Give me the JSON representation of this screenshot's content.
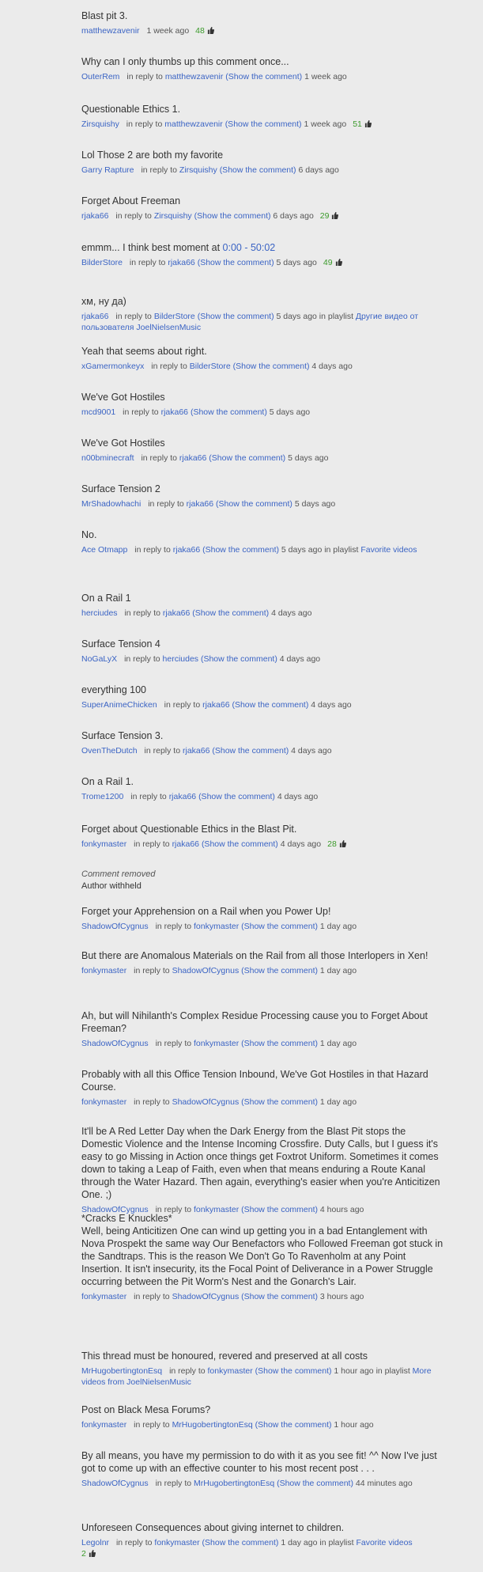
{
  "comments": [
    {
      "text": "Blast pit 3.",
      "user": "matthewzavenir",
      "reply_prefix": "",
      "reply_to": "",
      "show": "",
      "time": "1 week ago",
      "likes": "48"
    },
    {
      "text": "Why can I only thumbs up this comment once...",
      "user": "OuterRem",
      "reply_prefix": "in reply to",
      "reply_to": "matthewzavenir",
      "show": "(Show the comment)",
      "time": "1 week ago"
    },
    {
      "text": "Questionable Ethics 1.",
      "user": "Zirsquishy",
      "reply_prefix": "in reply to",
      "reply_to": "matthewzavenir",
      "show": "(Show the comment)",
      "time": "1 week ago",
      "likes": "51"
    },
    {
      "text": "Lol Those 2 are both my favorite",
      "user": "Garry Rapture",
      "reply_prefix": "in reply to",
      "reply_to": "Zirsquishy",
      "show": "(Show the comment)",
      "time": "6 days ago"
    },
    {
      "text": "Forget About Freeman",
      "user": "rjaka66",
      "reply_prefix": "in reply to",
      "reply_to": "Zirsquishy",
      "show": "(Show the comment)",
      "time": "6 days ago",
      "likes": "29"
    },
    {
      "text": "emmm... I think best moment at ",
      "link": "0:00 - 50:02",
      "user": "BilderStore",
      "reply_prefix": "in reply to",
      "reply_to": "rjaka66",
      "show": "(Show the comment)",
      "time": "5 days ago",
      "likes": "49"
    },
    {
      "text": "хм, ну да)",
      "user": "rjaka66",
      "reply_prefix": "in reply to",
      "reply_to": "BilderStore",
      "show": "(Show the comment)",
      "time": "5 days ago",
      "playlist_prefix": "in playlist",
      "playlist": "Другие видео от пользователя JoelNielsenMusic"
    },
    {
      "text": "Yeah that seems about right.",
      "user": "xGamermonkeyx",
      "reply_prefix": "in reply to",
      "reply_to": "BilderStore",
      "show": "(Show the comment)",
      "time": "4 days ago"
    },
    {
      "text": "We've Got Hostiles",
      "user": "mcd9001",
      "reply_prefix": "in reply to",
      "reply_to": "rjaka66",
      "show": "(Show the comment)",
      "time": "5 days ago"
    },
    {
      "text": "We've Got Hostiles",
      "user": "n00bminecraft",
      "reply_prefix": "in reply to",
      "reply_to": "rjaka66",
      "show": "(Show the comment)",
      "time": "5 days ago"
    },
    {
      "text": "Surface Tension 2",
      "user": "MrShadowhachi",
      "reply_prefix": "in reply to",
      "reply_to": "rjaka66",
      "show": "(Show the comment)",
      "time": "5 days ago"
    },
    {
      "text": "No.",
      "user": "Ace Otmapp",
      "reply_prefix": "in reply to",
      "reply_to": "rjaka66",
      "show": "(Show the comment)",
      "time": "5 days ago",
      "playlist_prefix": "in playlist",
      "playlist": "Favorite videos"
    },
    {
      "text": "On a Rail 1",
      "user": "herciudes",
      "reply_prefix": "in reply to",
      "reply_to": "rjaka66",
      "show": "(Show the comment)",
      "time": "4 days ago"
    },
    {
      "text": "Surface Tension 4",
      "user": "NoGaLyX",
      "reply_prefix": "in reply to",
      "reply_to": "herciudes",
      "show": "(Show the comment)",
      "time": "4 days ago"
    },
    {
      "text": "everything 100",
      "user": "SuperAnimeChicken",
      "reply_prefix": "in reply to",
      "reply_to": "rjaka66",
      "show": "(Show the comment)",
      "time": "4 days ago"
    },
    {
      "text": "Surface Tension 3.",
      "user": "OvenTheDutch",
      "reply_prefix": "in reply to",
      "reply_to": "rjaka66",
      "show": "(Show the comment)",
      "time": "4 days ago"
    },
    {
      "text": "On a Rail 1.",
      "user": "Trome1200",
      "reply_prefix": "in reply to",
      "reply_to": "rjaka66",
      "show": "(Show the comment)",
      "time": "4 days ago"
    },
    {
      "text": "Forget about Questionable Ethics in the Blast Pit.",
      "user": "fonkymaster",
      "reply_prefix": "in reply to",
      "reply_to": "rjaka66",
      "show": "(Show the comment)",
      "time": "4 days ago",
      "likes": "28"
    },
    {
      "removed": true,
      "text": "Comment removed",
      "withheld": "Author withheld"
    },
    {
      "text": "Forget your Apprehension on a Rail when you Power Up!",
      "user": "ShadowOfCygnus",
      "reply_prefix": "in reply to",
      "reply_to": "fonkymaster",
      "show": "(Show the comment)",
      "time": "1 day ago"
    },
    {
      "text": "But there are Anomalous Materials on the Rail from all those Interlopers in Xen!",
      "user": "fonkymaster",
      "reply_prefix": "in reply to",
      "reply_to": "ShadowOfCygnus",
      "show": "(Show the comment)",
      "time": "1 day ago"
    },
    {
      "text": "Ah, but will Nihilanth's Complex Residue Processing cause you to Forget About Freeman?",
      "user": "ShadowOfCygnus",
      "reply_prefix": "in reply to",
      "reply_to": "fonkymaster",
      "show": "(Show the comment)",
      "time": "1 day ago"
    },
    {
      "text": "Probably with all this Office Tension Inbound, We've Got Hostiles in that Hazard Course.",
      "user": "fonkymaster",
      "reply_prefix": "in reply to",
      "reply_to": "ShadowOfCygnus",
      "show": "(Show the comment)",
      "time": "1 day ago"
    },
    {
      "text": "It'll be A Red Letter Day when the Dark Energy from the Blast Pit stops the Domestic Violence and the Intense Incoming Crossfire. Duty Calls, but I guess it's easy to go Missing in Action once things get Foxtrot Uniform. Sometimes it comes down to taking a Leap of Faith, even when that means enduring a Route Kanal through the Water Hazard. Then again, everything's easier when you're Anticitizen One. ;)",
      "user": "ShadowOfCygnus",
      "reply_prefix": "in reply to",
      "reply_to": "fonkymaster",
      "show": "(Show the comment)",
      "time": "4 hours ago"
    },
    {
      "text": "*Cracks E Knuckles*\nWell, being Anticitizen One can wind up getting you in a bad Entanglement with Nova Prospekt the same way Our Benefactors who Followed Freeman got stuck in the Sandtraps. This is the reason We Don't Go To Ravenholm at any Point Insertion. It isn't insecurity, its the Focal Point of Deliverance in a Power Struggle occurring between the Pit Worm's Nest and the Gonarch's Lair.",
      "user": "fonkymaster",
      "reply_prefix": "in reply to",
      "reply_to": "ShadowOfCygnus",
      "show": "(Show the comment)",
      "time": "3 hours ago"
    },
    {
      "text": "This thread must be honoured, revered and preserved at all costs",
      "user": "MrHugobertingtonEsq",
      "reply_prefix": "in reply to",
      "reply_to": "fonkymaster",
      "show": "(Show the comment)",
      "time": "1 hour ago",
      "playlist_prefix": "in playlist",
      "playlist": "More videos from JoelNielsenMusic"
    },
    {
      "text": "Post on Black Mesa Forums?",
      "user": "fonkymaster",
      "reply_prefix": "in reply to",
      "reply_to": "MrHugobertingtonEsq",
      "show": "(Show the comment)",
      "time": "1 hour ago"
    },
    {
      "text": "By all means, you have my permission to do with it as you see fit! ^^ Now I've just got to come up with an effective counter to his most recent post . . .",
      "user": "ShadowOfCygnus",
      "reply_prefix": "in reply to",
      "reply_to": "MrHugobertingtonEsq",
      "show": "(Show the comment)",
      "time": "44 minutes ago"
    },
    {
      "text": "Unforeseen Consequences about giving internet to children.",
      "user": "Legolnr",
      "reply_prefix": "in reply to",
      "reply_to": "fonkymaster",
      "show": "(Show the comment)",
      "time": "1 day ago",
      "playlist_prefix": "in playlist",
      "playlist": "Favorite videos",
      "likes": "2"
    }
  ],
  "colors": {
    "link": "#3b64c4",
    "likes": "#3a9a2a",
    "text": "#333333",
    "background": "#ebebeb"
  },
  "icons": {
    "like": "thumbs-up-icon"
  }
}
